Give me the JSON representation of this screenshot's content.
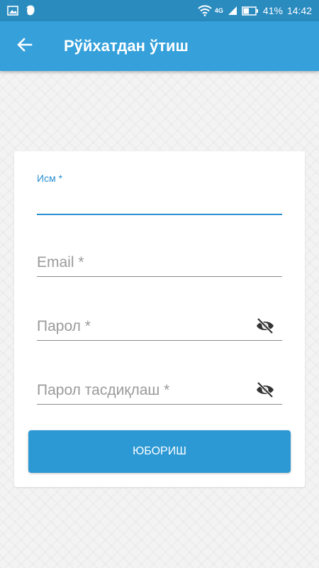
{
  "status_bar": {
    "network": "4G",
    "battery": "41%",
    "time": "14:42",
    "icons": [
      "image-icon",
      "evernote-icon",
      "wifi-icon",
      "signal-icon",
      "battery-icon"
    ]
  },
  "app_bar": {
    "title": "Рўйхатдан ўтиш",
    "back_icon": "arrow-left-icon"
  },
  "form": {
    "name_label": "Исм *",
    "name_value": "",
    "email_placeholder": "Email *",
    "password_placeholder": "Парол *",
    "confirm_placeholder": "Парол тасдиқлаш *",
    "submit_label": "ЮБОРИШ"
  },
  "colors": {
    "status_bar": "#2a8bbf",
    "app_bar": "#35a0da",
    "accent": "#2a8fd0",
    "button": "#2d99d4"
  }
}
